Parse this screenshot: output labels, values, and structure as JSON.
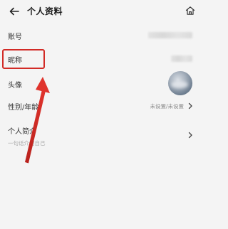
{
  "header": {
    "back_icon": "arrow-left-icon",
    "title": "个人资料",
    "home_icon": "home-icon"
  },
  "rows": {
    "account": {
      "label": "账号"
    },
    "nickname": {
      "label": "昵称"
    },
    "avatar": {
      "label": "头像"
    },
    "gender_age": {
      "label": "性别/年龄",
      "value": "未设置/未设置"
    },
    "bio": {
      "label": "个人简介",
      "sub": "一句话介绍自己"
    }
  },
  "annotation": {
    "color": "#d22b26"
  }
}
